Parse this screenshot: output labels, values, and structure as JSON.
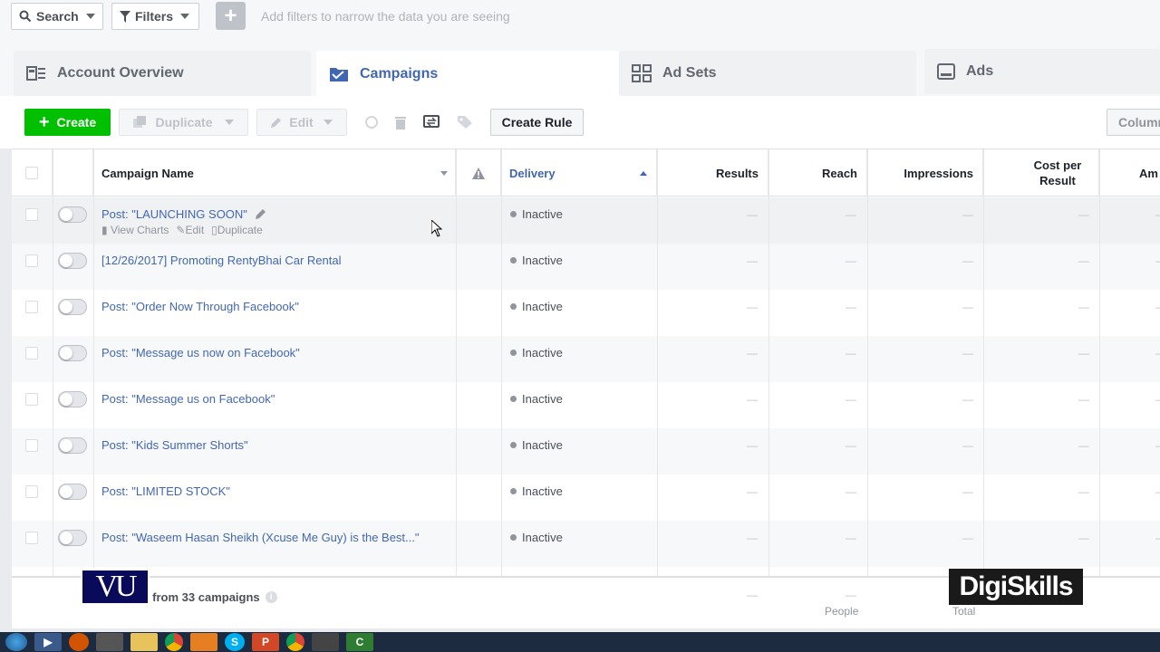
{
  "filterbar": {
    "search_label": "Search",
    "filters_label": "Filters",
    "hint": "Add filters to narrow the data you are seeing"
  },
  "tabs": [
    {
      "label": "Account Overview",
      "icon": "account-overview-icon"
    },
    {
      "label": "Campaigns",
      "icon": "folder-icon",
      "active": true
    },
    {
      "label": "Ad Sets",
      "icon": "grid-icon"
    },
    {
      "label": "Ads",
      "icon": "ad-icon"
    }
  ],
  "toolbar": {
    "create_label": "Create",
    "duplicate_label": "Duplicate",
    "edit_label": "Edit",
    "create_rule_label": "Create Rule",
    "columns_label": "Columns"
  },
  "table": {
    "headers": {
      "name": "Campaign Name",
      "delivery": "Delivery",
      "results": "Results",
      "reach": "Reach",
      "impressions": "Impressions",
      "cost": "Cost per Result",
      "amount": "Am"
    },
    "row_actions": {
      "view_charts": "View Charts",
      "edit": "Edit",
      "duplicate": "Duplicate"
    },
    "rows": [
      {
        "name": "Post: \"LAUNCHING SOON\"",
        "delivery": "Inactive"
      },
      {
        "name": "[12/26/2017] Promoting RentyBhai Car Rental",
        "delivery": "Inactive"
      },
      {
        "name": "Post: \"Order Now Through Facebook\"",
        "delivery": "Inactive"
      },
      {
        "name": "Post: \"Message us now on Facebook\"",
        "delivery": "Inactive"
      },
      {
        "name": "Post: \"Message us on Facebook\"",
        "delivery": "Inactive"
      },
      {
        "name": "Post: \"Kids Summer Shorts\"",
        "delivery": "Inactive"
      },
      {
        "name": "Post: \"LIMITED STOCK\"",
        "delivery": "Inactive"
      },
      {
        "name": "Post: \"Waseem Hasan Sheikh (Xcuse Me Guy) is the Best...\"",
        "delivery": "Inactive"
      }
    ],
    "dash": "—",
    "footer": {
      "summary": "ts from 33 campaigns",
      "reach_sub": "People",
      "impressions_sub": "Total"
    }
  },
  "watermarks": {
    "vu": "VU",
    "digiskills": "DigiSkills"
  },
  "colors": {
    "accent": "#4267b2",
    "create_green": "#00c000"
  }
}
